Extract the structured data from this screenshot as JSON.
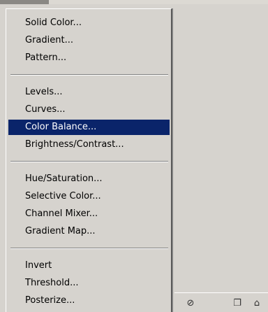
{
  "menu": {
    "groups": [
      [
        "Solid Color...",
        "Gradient...",
        "Pattern..."
      ],
      [
        "Levels...",
        "Curves...",
        "Color Balance...",
        "Brightness/Contrast..."
      ],
      [
        "Hue/Saturation...",
        "Selective Color...",
        "Channel Mixer...",
        "Gradient Map..."
      ],
      [
        "Invert",
        "Threshold...",
        "Posterize..."
      ]
    ],
    "selected": "Color Balance..."
  },
  "panel_icons": [
    "fill-adjustment-icon",
    "new-layer-icon",
    "trash-icon"
  ],
  "colors": {
    "menu_bg": "#d6d3ce",
    "highlight": "#0a246a",
    "highlight_text": "#ffffff"
  }
}
